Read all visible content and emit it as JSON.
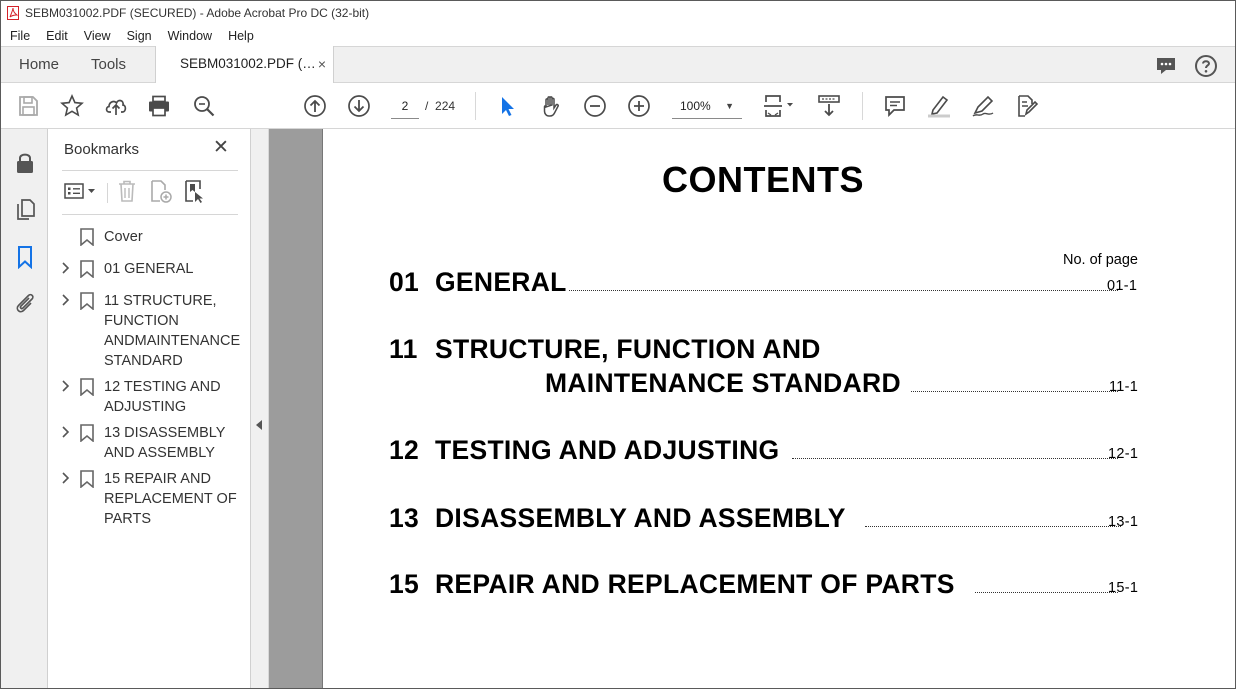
{
  "window": {
    "title": "SEBM031002.PDF (SECURED) - Adobe Acrobat Pro DC (32-bit)"
  },
  "menu": [
    "File",
    "Edit",
    "View",
    "Sign",
    "Window",
    "Help"
  ],
  "tabs": {
    "home": "Home",
    "tools": "Tools",
    "document": "SEBM031002.PDF (…",
    "close": "×"
  },
  "toolbar": {
    "page_current": "2",
    "page_separator": "/",
    "page_total": "224",
    "zoom": "100%"
  },
  "bookmarks": {
    "title": "Bookmarks",
    "close": "✕",
    "items": [
      {
        "label": "Cover",
        "expandable": false
      },
      {
        "label": "01 GENERAL",
        "expandable": true
      },
      {
        "label": "11 STRUCTURE,\nFUNCTION\nANDMAINTENANCE\nSTANDARD",
        "expandable": true
      },
      {
        "label": "12 TESTING AND\nADJUSTING",
        "expandable": true
      },
      {
        "label": "13 DISASSEMBLY\nAND ASSEMBLY",
        "expandable": true
      },
      {
        "label": "15 REPAIR AND\nREPLACEMENT OF\nPARTS",
        "expandable": true
      }
    ]
  },
  "document": {
    "title": "CONTENTS",
    "no_of_page": "No. of page",
    "entries": [
      {
        "num": "01",
        "text": "GENERAL",
        "page": "01-1"
      },
      {
        "num": "11",
        "text": "STRUCTURE, FUNCTION AND",
        "text2": "MAINTENANCE STANDARD",
        "page": "11-1"
      },
      {
        "num": "12",
        "text": "TESTING AND ADJUSTING",
        "page": "12-1"
      },
      {
        "num": "13",
        "text": "DISASSEMBLY AND ASSEMBLY",
        "page": "13-1"
      },
      {
        "num": "15",
        "text": "REPAIR AND REPLACEMENT OF PARTS",
        "page": "15-1"
      }
    ]
  },
  "colors": {
    "accent": "#1473e6",
    "acrobat_red": "#d4222a",
    "icon": "#4b4b4b"
  }
}
